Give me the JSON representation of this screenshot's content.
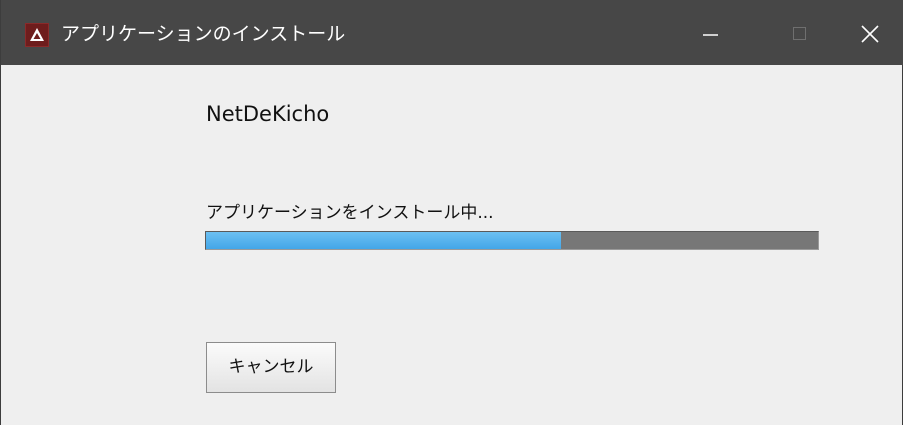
{
  "window": {
    "title": "アプリケーションのインストール",
    "controls": {
      "minimize_icon": "minimize-icon",
      "maximize_icon": "maximize-icon",
      "close_icon": "close-icon"
    }
  },
  "main": {
    "product_name": "NetDeKicho",
    "status": "アプリケーションをインストール中...",
    "progress_fraction": 0.58,
    "cancel_label": "キャンセル"
  },
  "colors": {
    "titlebar": "#474747",
    "progress_fill": "#43a6e8",
    "progress_track": "#777777",
    "app_icon": "#6e1d1d"
  }
}
